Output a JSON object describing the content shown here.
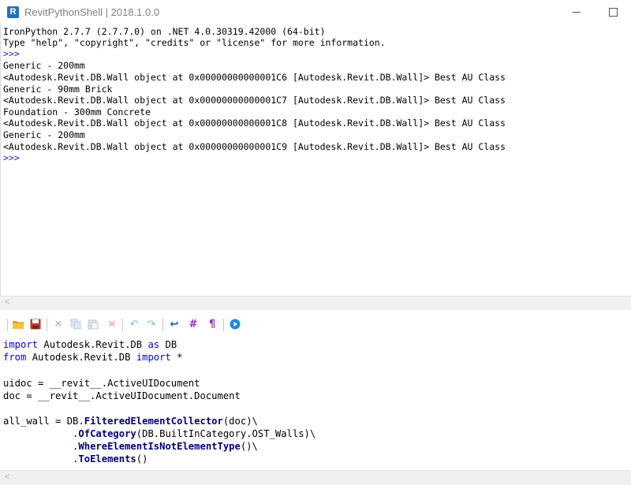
{
  "window": {
    "title": "RevitPythonShell | 2018.1.0.0",
    "app_icon_letter": "R"
  },
  "console": {
    "lines": [
      "IronPython 2.7.7 (2.7.7.0) on .NET 4.0.30319.42000 (64-bit)",
      "Type \"help\", \"copyright\", \"credits\" or \"license\" for more information.",
      ">>>",
      "Generic - 200mm",
      "<Autodesk.Revit.DB.Wall object at 0x00000000000001C6 [Autodesk.Revit.DB.Wall]> Best AU Class",
      "Generic - 90mm Brick",
      "<Autodesk.Revit.DB.Wall object at 0x00000000000001C7 [Autodesk.Revit.DB.Wall]> Best AU Class",
      "Foundation - 300mm Concrete",
      "<Autodesk.Revit.DB.Wall object at 0x00000000000001C8 [Autodesk.Revit.DB.Wall]> Best AU Class",
      "Generic - 200mm",
      "<Autodesk.Revit.DB.Wall object at 0x00000000000001C9 [Autodesk.Revit.DB.Wall]> Best AU Class",
      ">>>"
    ]
  },
  "scroll": {
    "left_arrow": "<"
  },
  "toolbar": {
    "icons": {
      "open": "folder-icon",
      "save": "save-icon",
      "cut": "cut-icon",
      "copy": "copy-icon",
      "paste": "paste-icon",
      "delete": "delete-icon",
      "undo": "undo-icon",
      "redo": "redo-icon",
      "wrap": "word-wrap-icon",
      "comment": "hash-icon",
      "whitespace": "pilcrow-icon",
      "run": "run-icon"
    },
    "glyphs": {
      "cut": "✕",
      "delete": "✕",
      "undo": "↶",
      "redo": "↷",
      "wrap": "↩",
      "comment": "#",
      "whitespace": "¶"
    }
  },
  "editor": {
    "line1": {
      "kw1": "import",
      "rest1": " Autodesk.Revit.DB ",
      "kw2": "as",
      "rest2": " DB"
    },
    "line2": {
      "kw1": "from",
      "rest1": " Autodesk.Revit.DB ",
      "kw2": "import",
      "rest2": " *"
    },
    "line3": "uidoc = __revit__.ActiveUIDocument",
    "line4": "doc = __revit__.ActiveUIDocument.Document",
    "line5": {
      "pre": "all_wall = DB.",
      "fn": "FilteredElementCollector",
      "post": "(doc)\\"
    },
    "line6": {
      "pre": "            .",
      "fn": "OfCategory",
      "post": "(DB.BuiltInCategory.OST_Walls)\\"
    },
    "line7": {
      "pre": "            .",
      "fn": "WhereElementIsNotElementType",
      "post": "()\\"
    },
    "line8": {
      "pre": "            .",
      "fn": "ToElements",
      "post": "()"
    }
  },
  "colors": {
    "keyword": "#0000ff",
    "function": "#000080",
    "prompt": "#1f1fd6",
    "accent_icon": "#1f73c5"
  }
}
